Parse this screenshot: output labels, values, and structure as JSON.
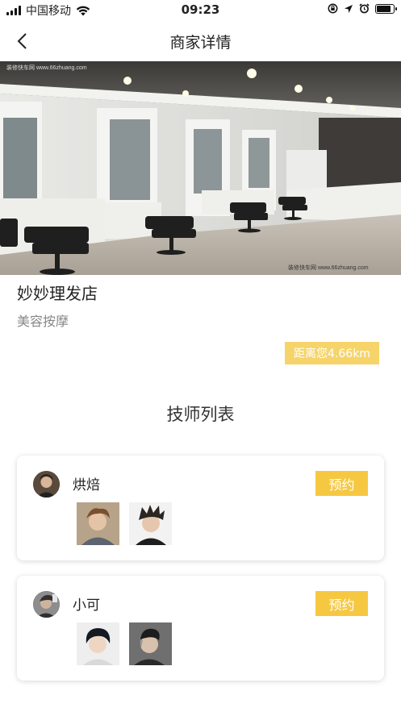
{
  "status_bar": {
    "carrier": "中国移动",
    "time": "09:23",
    "icons": [
      "signal-icon",
      "wifi-icon",
      "lock-rotation-icon",
      "location-icon",
      "alarm-icon",
      "battery-icon"
    ]
  },
  "nav": {
    "title": "商家详情",
    "back_icon": "chevron-left-icon"
  },
  "hero": {
    "watermark_top": "装修快车网 www.66zhuang.com",
    "watermark_bottom": "装修快车网 www.66zhuang.com"
  },
  "shop": {
    "name": "妙妙理发店",
    "category": "美容按摩",
    "distance": "距离您4.66km"
  },
  "section": {
    "title": "技师列表"
  },
  "technicians": [
    {
      "name": "烘焙",
      "book_label": "预约"
    },
    {
      "name": "小可",
      "book_label": "预约"
    }
  ],
  "colors": {
    "accent": "#f6c842",
    "distance_badge": "#f6d46a"
  }
}
